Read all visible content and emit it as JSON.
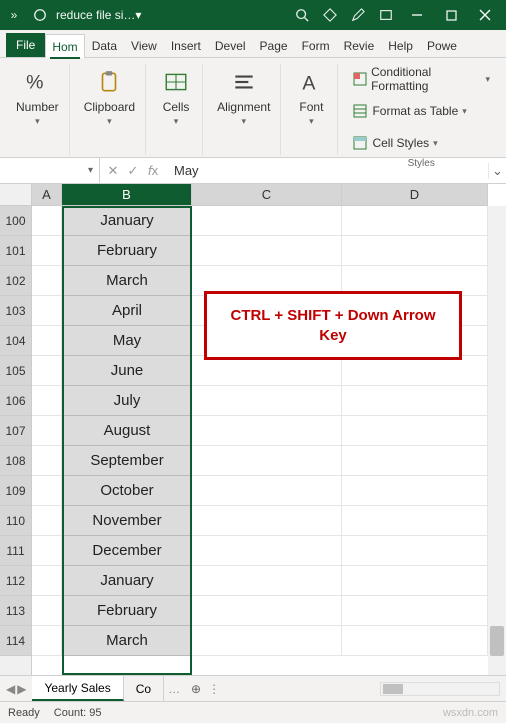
{
  "title": "reduce file si…",
  "tabs": [
    "File",
    "Hom",
    "Data",
    "View",
    "Insert",
    "Devel",
    "Page",
    "Form",
    "Revie",
    "Help",
    "Powe"
  ],
  "active_tab": "Hom",
  "ribbon": {
    "number": "Number",
    "clipboard": "Clipboard",
    "cells": "Cells",
    "alignment": "Alignment",
    "font": "Font",
    "styles_label": "Styles",
    "conditional": "Conditional Formatting",
    "table": "Format as Table",
    "cellstyles": "Cell Styles"
  },
  "namebox": "",
  "formula": "May",
  "col_headers": [
    "A",
    "B",
    "C",
    "D"
  ],
  "rows": [
    {
      "n": "100",
      "b": "January"
    },
    {
      "n": "101",
      "b": "February"
    },
    {
      "n": "102",
      "b": "March"
    },
    {
      "n": "103",
      "b": "April"
    },
    {
      "n": "104",
      "b": "May"
    },
    {
      "n": "105",
      "b": "June"
    },
    {
      "n": "106",
      "b": "July"
    },
    {
      "n": "107",
      "b": "August"
    },
    {
      "n": "108",
      "b": "September"
    },
    {
      "n": "109",
      "b": "October"
    },
    {
      "n": "110",
      "b": "November"
    },
    {
      "n": "111",
      "b": "December"
    },
    {
      "n": "112",
      "b": "January"
    },
    {
      "n": "113",
      "b": "February"
    },
    {
      "n": "114",
      "b": "March"
    }
  ],
  "callout": "CTRL + SHIFT + Down Arrow Key",
  "sheets": {
    "active": "Yearly Sales",
    "next": "Co"
  },
  "status": {
    "mode": "Ready",
    "count_label": "Count:",
    "count": "95"
  },
  "watermark": "wsxdn.com"
}
